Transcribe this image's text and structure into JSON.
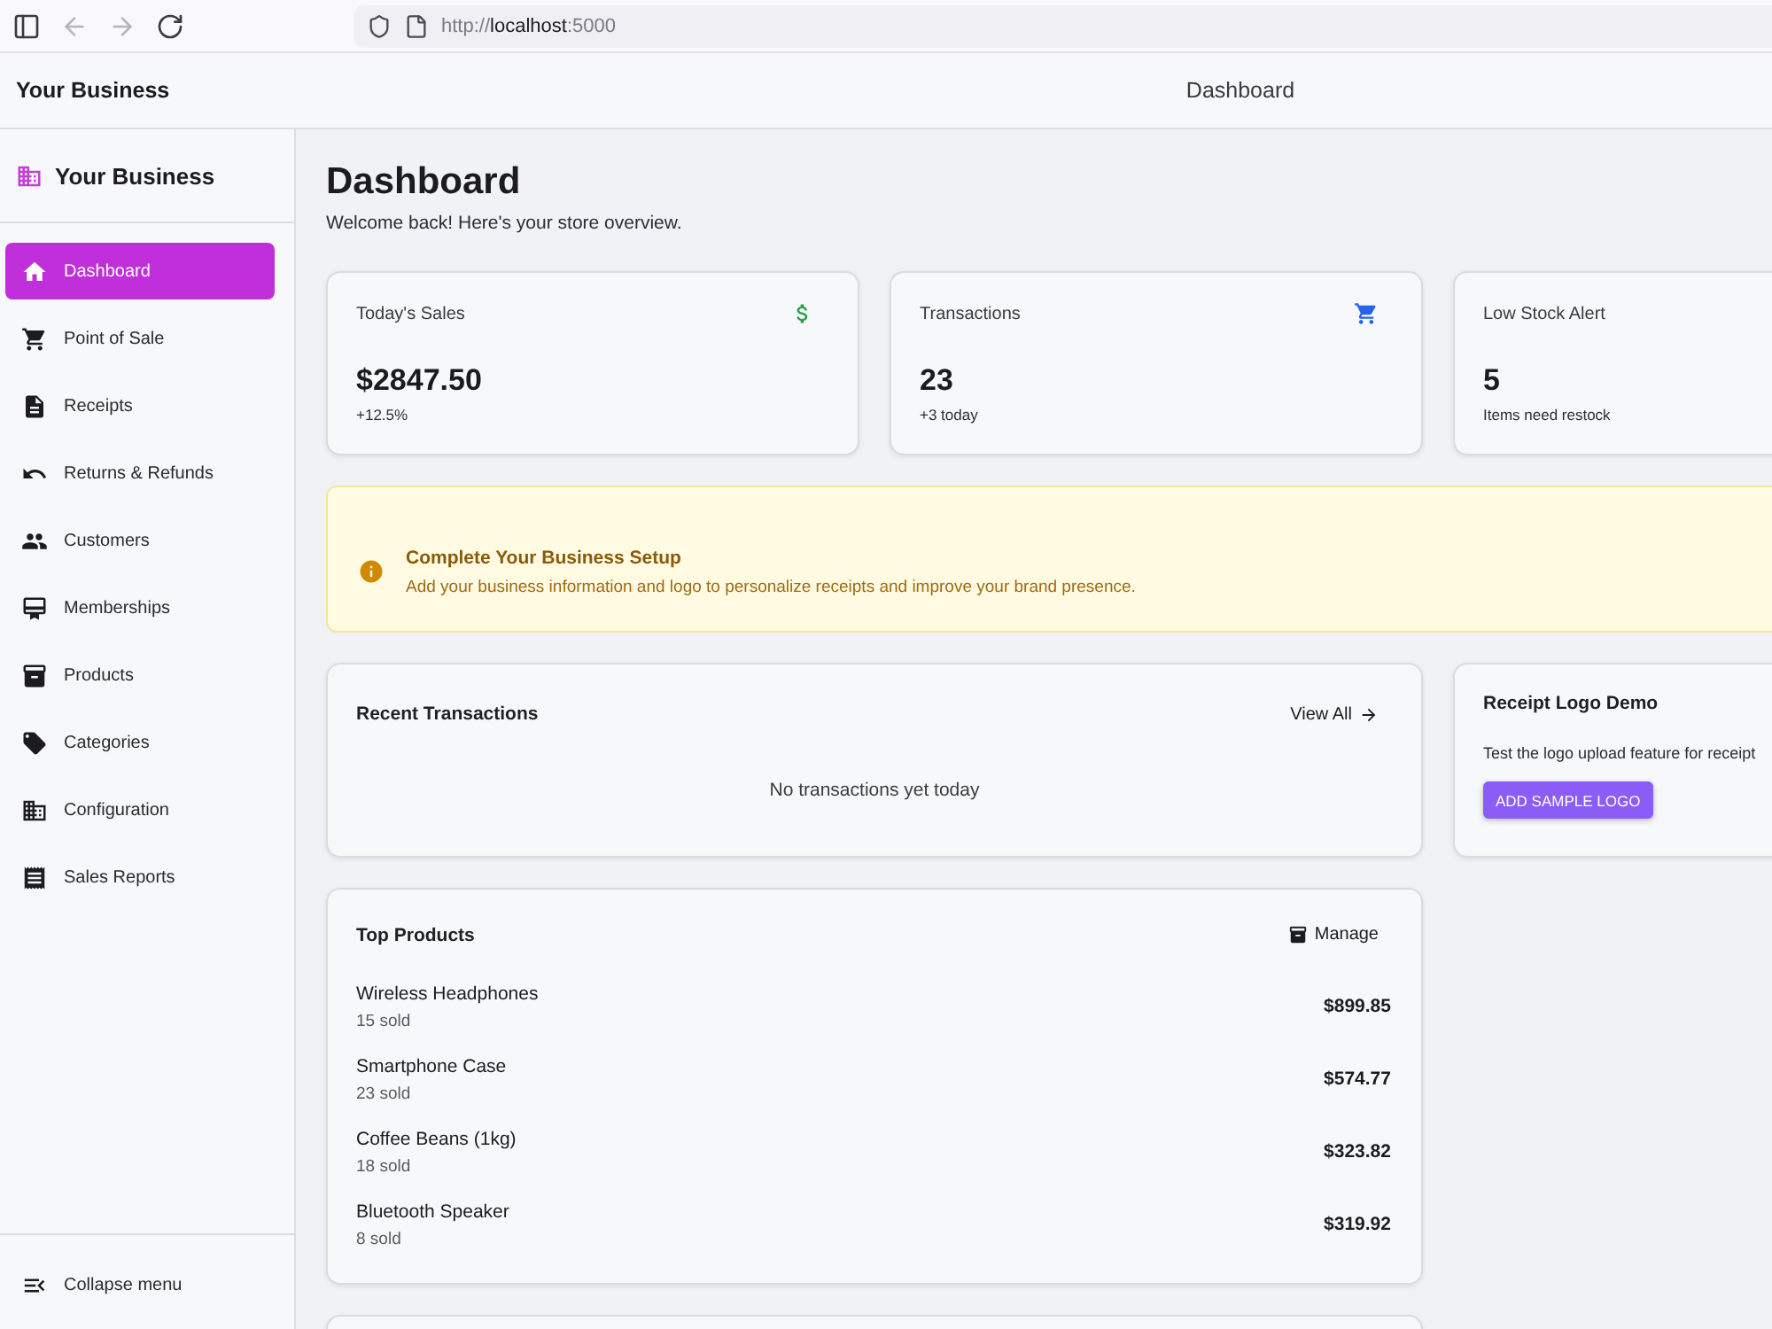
{
  "browser": {
    "url": "http://**localhost**:5000"
  },
  "header": {
    "brand": "Your Business",
    "title": "Dashboard"
  },
  "sidebar": {
    "brand": "Your Business",
    "items": [
      {
        "label": "Dashboard",
        "selected": true
      },
      {
        "label": "Point of Sale",
        "selected": false
      },
      {
        "label": "Receipts",
        "selected": false
      },
      {
        "label": "Returns & Refunds",
        "selected": false
      },
      {
        "label": "Customers",
        "selected": false
      },
      {
        "label": "Memberships",
        "selected": false
      },
      {
        "label": "Products",
        "selected": false
      },
      {
        "label": "Categories",
        "selected": false
      },
      {
        "label": "Configuration",
        "selected": false
      },
      {
        "label": "Sales Reports",
        "selected": false
      }
    ],
    "footer": "Collapse menu"
  },
  "page": {
    "title": "Dashboard",
    "subtitle": "Welcome back! Here's your store overview."
  },
  "stats": [
    {
      "label": "Today's Sales",
      "value": "$2847.50",
      "note": "+12.5%"
    },
    {
      "label": "Transactions",
      "value": "23",
      "note": "+3 today"
    },
    {
      "label": "Low Stock Alert",
      "value": "5",
      "note": "Items need restock"
    }
  ],
  "setup_banner": {
    "title": "Complete Your Business Setup",
    "text": "Add your business information and logo to personalize receipts and improve your brand presence."
  },
  "recent_transactions": {
    "title": "Recent Transactions",
    "link": "View All",
    "empty": "No transactions yet today"
  },
  "logo_demo": {
    "title": "Receipt Logo Demo",
    "text": "Test the logo upload feature for receipt",
    "button": "ADD SAMPLE LOGO"
  },
  "top_products": {
    "title": "Top Products",
    "action": "Manage",
    "rows": [
      {
        "name": "Wireless Headphones",
        "sold": "15 sold",
        "revenue": "$899.85"
      },
      {
        "name": "Smartphone Case",
        "sold": "23 sold",
        "revenue": "$574.77"
      },
      {
        "name": "Coffee Beans (1kg)",
        "sold": "18 sold",
        "revenue": "$323.82"
      },
      {
        "name": "Bluetooth Speaker",
        "sold": "8 sold",
        "revenue": "$319.92"
      }
    ]
  }
}
